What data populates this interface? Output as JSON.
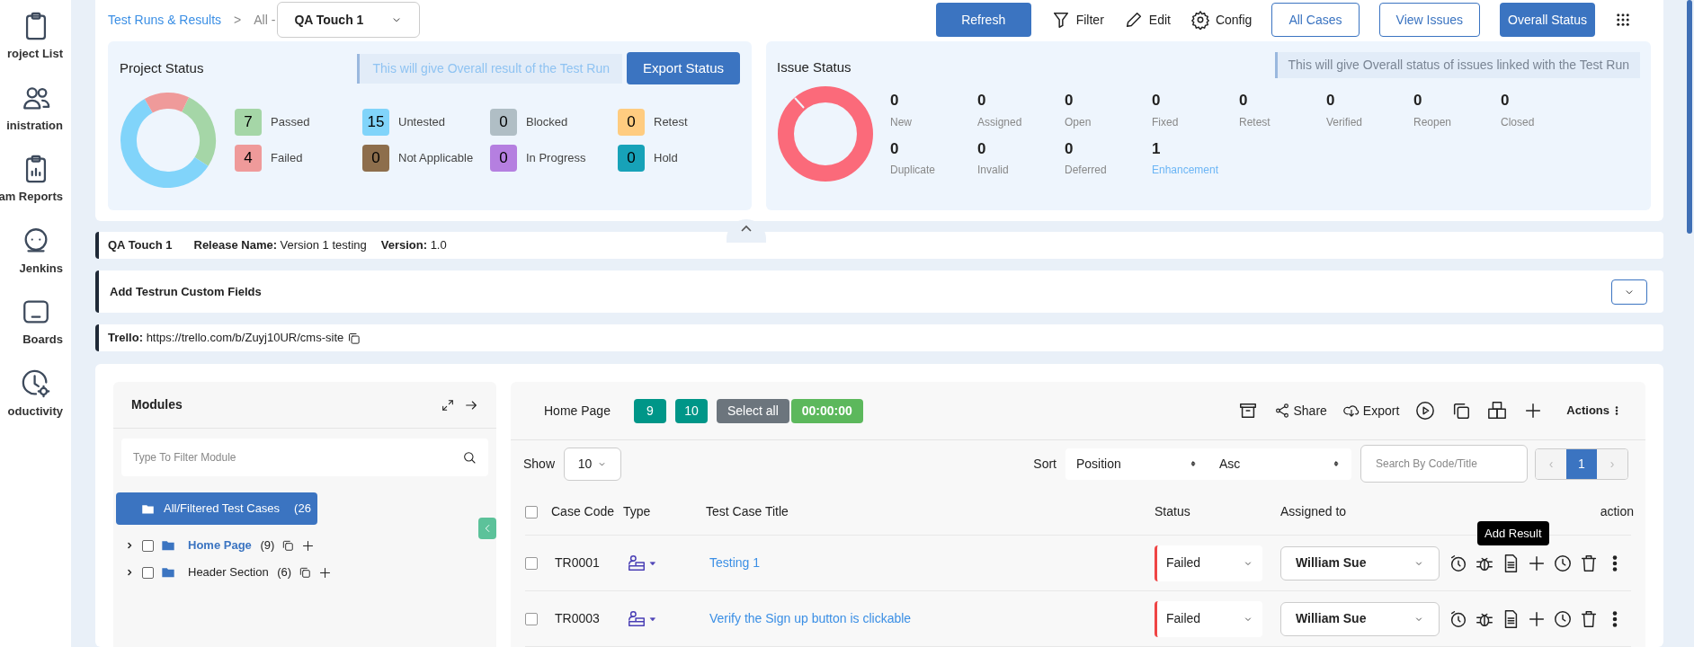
{
  "sidebar": {
    "items": [
      {
        "label": "roject List",
        "kind": "clipboard"
      },
      {
        "label": "inistration",
        "kind": "people"
      },
      {
        "label": "am Reports",
        "kind": "report"
      },
      {
        "label": "Jenkins",
        "kind": "jenkins"
      },
      {
        "label": "Boards",
        "kind": "board"
      },
      {
        "label": "oductivity",
        "kind": "productivity"
      }
    ]
  },
  "breadcrumb": {
    "link": "Test Runs & Results",
    "separator": ">",
    "current": "All -",
    "select": "QA Touch 1"
  },
  "toolbar": [
    {
      "label": "Refresh",
      "kind": "primary"
    },
    {
      "label": "Filter",
      "kind": "filter"
    },
    {
      "label": "Edit",
      "kind": "edit"
    },
    {
      "label": "Config",
      "kind": "config"
    },
    {
      "label": "All Cases",
      "kind": "outline"
    },
    {
      "label": "View Issues",
      "kind": "outline"
    },
    {
      "label": "Overall Status",
      "kind": "primary"
    },
    {
      "kind": "apps"
    }
  ],
  "project_status": {
    "title": "Project Status",
    "hint": "This will give Overall result of the Test Run",
    "export_button": "Export Status",
    "legend": [
      {
        "count": "7",
        "label": "Passed",
        "color": "#a5d6a7"
      },
      {
        "count": "15",
        "label": "Untested",
        "color": "#81d4fa"
      },
      {
        "count": "0",
        "label": "Blocked",
        "color": "#b0bec5"
      },
      {
        "count": "0",
        "label": "Retest",
        "color": "#ffcc80"
      },
      {
        "count": "4",
        "label": "Failed",
        "color": "#ef9a9a"
      },
      {
        "count": "0",
        "label": "Not Applicable",
        "color": "#8d6e4c"
      },
      {
        "count": "0",
        "label": "In Progress",
        "color": "#b57fe0"
      },
      {
        "count": "0",
        "label": "Hold",
        "color": "#17a2b8"
      }
    ]
  },
  "issue_status": {
    "title": "Issue Status",
    "hint": "This will give Overall status of issues linked with the Test Run",
    "items": [
      {
        "count": "0",
        "label": "New",
        "kind": "plain"
      },
      {
        "count": "0",
        "label": "Assigned",
        "kind": "plain"
      },
      {
        "count": "0",
        "label": "Open",
        "kind": "plain"
      },
      {
        "count": "0",
        "label": "Fixed",
        "kind": "plain"
      },
      {
        "count": "0",
        "label": "Retest",
        "kind": "plain"
      },
      {
        "count": "0",
        "label": "Verified",
        "kind": "plain"
      },
      {
        "count": "0",
        "label": "Reopen",
        "kind": "plain"
      },
      {
        "count": "0",
        "label": "Closed",
        "kind": "plain"
      },
      {
        "count": "0",
        "label": "Duplicate",
        "kind": "plain"
      },
      {
        "count": "0",
        "label": "Invalid",
        "kind": "plain"
      },
      {
        "count": "0",
        "label": "Deferred",
        "kind": "plain"
      },
      {
        "count": "1",
        "label": "Enhancement",
        "kind": "link"
      }
    ]
  },
  "run_info": {
    "project": "QA Touch 1",
    "release_label": "Release Name:",
    "release": "Version 1 testing",
    "version_label": "Version:",
    "version": "1.0"
  },
  "custom_fields": {
    "title": "Add Testrun Custom Fields",
    "expanded": false
  },
  "trello": {
    "label": "Trello:",
    "url": "https://trello.com/b/Zuyj10UR/cms-site"
  },
  "modules": {
    "title": "Modules",
    "filter_placeholder": "Type To Filter Module",
    "tree": [
      {
        "label": "All/Filtered Test Cases",
        "count": "(26",
        "kind": "all",
        "selected": true
      },
      {
        "label": "Home Page",
        "count": "(9)",
        "kind": "module",
        "selected": false,
        "current": true,
        "checked": false,
        "expanded": false
      },
      {
        "label": "Header Section",
        "count": "(6)",
        "kind": "module",
        "selected": false,
        "current": false,
        "checked": false,
        "expanded": false
      }
    ]
  },
  "test_cases": {
    "module": "Home Page",
    "badges": [
      "9",
      "10"
    ],
    "select_all": "Select all",
    "timer": "00:00:00",
    "tools": [
      {
        "kind": "archive"
      },
      {
        "label": "Share",
        "kind": "share"
      },
      {
        "label": "Export",
        "kind": "export"
      },
      {
        "kind": "play"
      },
      {
        "kind": "copy"
      },
      {
        "kind": "boxes"
      },
      {
        "kind": "plus"
      }
    ],
    "select_all_checked": false,
    "actions": "Actions",
    "show_label": "Show",
    "page_size": "10",
    "sort_label": "Sort",
    "sort_field": "Position",
    "sort_order": "Asc",
    "search_placeholder": "Search By Code/Title",
    "pagination": {
      "prev": "‹",
      "pages": [
        {
          "label": "1",
          "selected": true
        }
      ],
      "next": "›"
    },
    "columns": [
      "Case Code",
      "Type",
      "Test Case Title",
      "Status",
      "Assigned to",
      "action"
    ],
    "rows": [
      {
        "checked": false,
        "code": "TR0001",
        "title": "Testing 1",
        "status": "Failed",
        "color": "#ef4444",
        "assignee": "William Sue"
      },
      {
        "checked": false,
        "code": "TR0003",
        "title": "Verify the Sign up button is clickable",
        "status": "Failed",
        "color": "#ef4444",
        "assignee": "William Sue"
      }
    ],
    "tooltip": "Add Result"
  }
}
